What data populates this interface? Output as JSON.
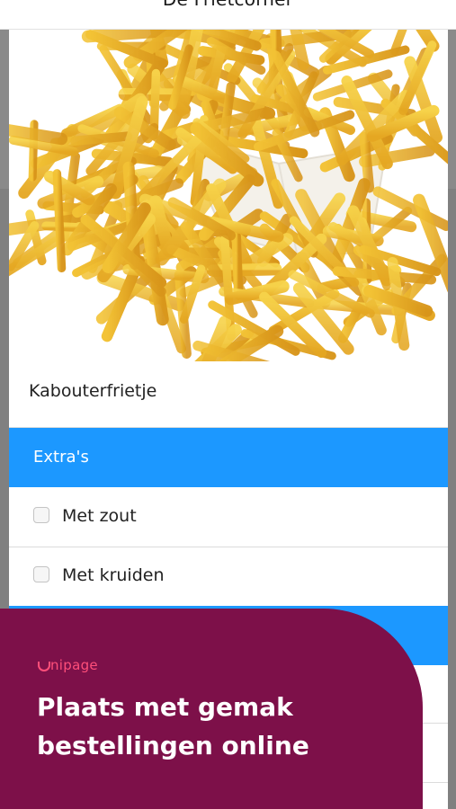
{
  "header": {
    "title": "De Frietcorner"
  },
  "product": {
    "image_icon": "fries-image",
    "name": "Kabouterfrietje"
  },
  "sections": [
    {
      "title": "Extra's",
      "options": [
        {
          "label": "Met zout",
          "checked": false
        },
        {
          "label": "Met kruiden",
          "checked": false
        }
      ]
    }
  ],
  "promo": {
    "brand": "nipage",
    "headline_line1": "Plaats met gemak",
    "headline_line2": "bestellingen online"
  },
  "colors": {
    "accent": "#1c98ff",
    "promo_bg": "#7d1049",
    "promo_brand": "#ff4f7a"
  }
}
